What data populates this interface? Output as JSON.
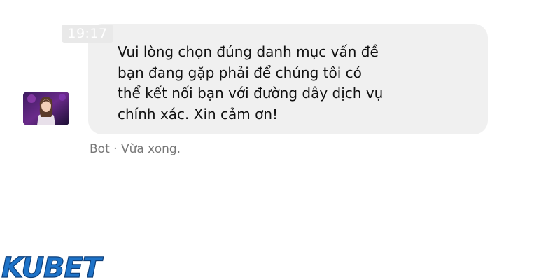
{
  "message": {
    "time": "19:17",
    "lines": [
      "Vui lòng chọn đúng danh mục vấn đề",
      "bạn đang gặp phải để chúng tôi có",
      "thể kết nối bạn với đường dây dịch vụ",
      "chính xác. Xin cảm ơn!"
    ],
    "sender": "Bot",
    "separator": "·",
    "status": "Vừa xong."
  },
  "watermark": {
    "brand": "KUBET",
    "colors": {
      "primary": "#1e73c8",
      "outline": "#0d3f7a"
    }
  },
  "colors": {
    "bubble": "#f0f0f0",
    "meta_text": "#777777"
  }
}
